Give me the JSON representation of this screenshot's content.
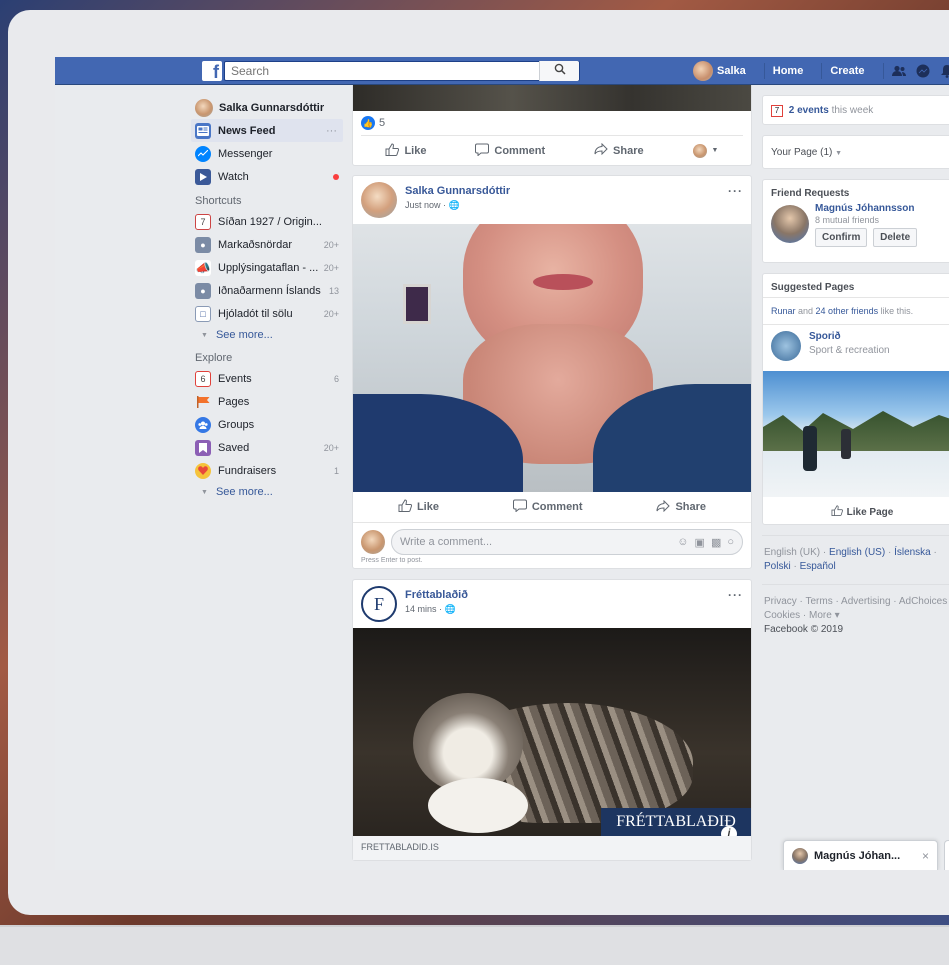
{
  "topbar": {
    "logo": "f",
    "search_placeholder": "Search",
    "user_name": "Salka",
    "nav_home": "Home",
    "nav_create": "Create"
  },
  "leftnav": {
    "user": "Salka Gunnarsdóttir",
    "main_items": [
      {
        "label": "News Feed",
        "icon": "news-feed-icon",
        "more": "···"
      },
      {
        "label": "Messenger",
        "icon": "messenger-icon"
      },
      {
        "label": "Watch",
        "icon": "watch-icon",
        "dot": true
      }
    ],
    "shortcuts_heading": "Shortcuts",
    "shortcuts": [
      {
        "label": "Síðan 1927 / Origin...",
        "count": ""
      },
      {
        "label": "Markaðsnördar",
        "count": "20+"
      },
      {
        "label": "Upplýsingataflan - ...",
        "count": "20+"
      },
      {
        "label": "Iðnaðarmenn Íslands",
        "count": "13"
      },
      {
        "label": "Hjóladót til sölu",
        "count": "20+"
      }
    ],
    "see_more": "See more...",
    "explore_heading": "Explore",
    "explore": [
      {
        "label": "Events",
        "count": "6"
      },
      {
        "label": "Pages",
        "count": ""
      },
      {
        "label": "Groups",
        "count": ""
      },
      {
        "label": "Saved",
        "count": "20+"
      },
      {
        "label": "Fundraisers",
        "count": "1"
      }
    ],
    "see_more_2": "See more..."
  },
  "feed": {
    "top_post": {
      "reactions": "5",
      "like": "Like",
      "comment": "Comment",
      "share": "Share"
    },
    "post1": {
      "author": "Salka Gunnarsdóttir",
      "meta": "Just now ·",
      "more": "···",
      "like": "Like",
      "comment": "Comment",
      "share": "Share",
      "comment_placeholder": "Write a comment...",
      "press_enter": "Press Enter to post."
    },
    "post2": {
      "author": "Fréttablaðið",
      "meta": "14 mins ·",
      "more": "···",
      "watermark": "FRÉTTABLAÐIÐ",
      "source": "FRETTABLADID.IS"
    }
  },
  "right": {
    "events_count": "2 events",
    "events_suffix": " this week",
    "your_page": "Your Page (1)",
    "friend_requests_title": "Friend Requests",
    "friend_name": "Magnús Jóhannsson",
    "friend_mutual": "8 mutual friends",
    "confirm": "Confirm",
    "delete": "Delete",
    "suggested_title": "Suggested Pages",
    "suggested_friend": "Runar",
    "suggested_and": " and ",
    "suggested_others": "24 other friends",
    "suggested_suffix": " like this.",
    "page_name": "Sporið",
    "page_category": "Sport & recreation",
    "like_page": "Like Page",
    "languages": [
      "English (UK)",
      "English (US)",
      "Íslenska",
      "Polski",
      "Español"
    ],
    "footer_line1": "Privacy · Terms · Advertising · AdChoices",
    "footer_line2": "Cookies · More ▾",
    "footer_line3": "Facebook © 2019"
  },
  "chat": {
    "tab_name": "Magnús Jóhan...",
    "close": "×"
  },
  "colors": {
    "brand": "#4267b2",
    "link": "#385898"
  }
}
